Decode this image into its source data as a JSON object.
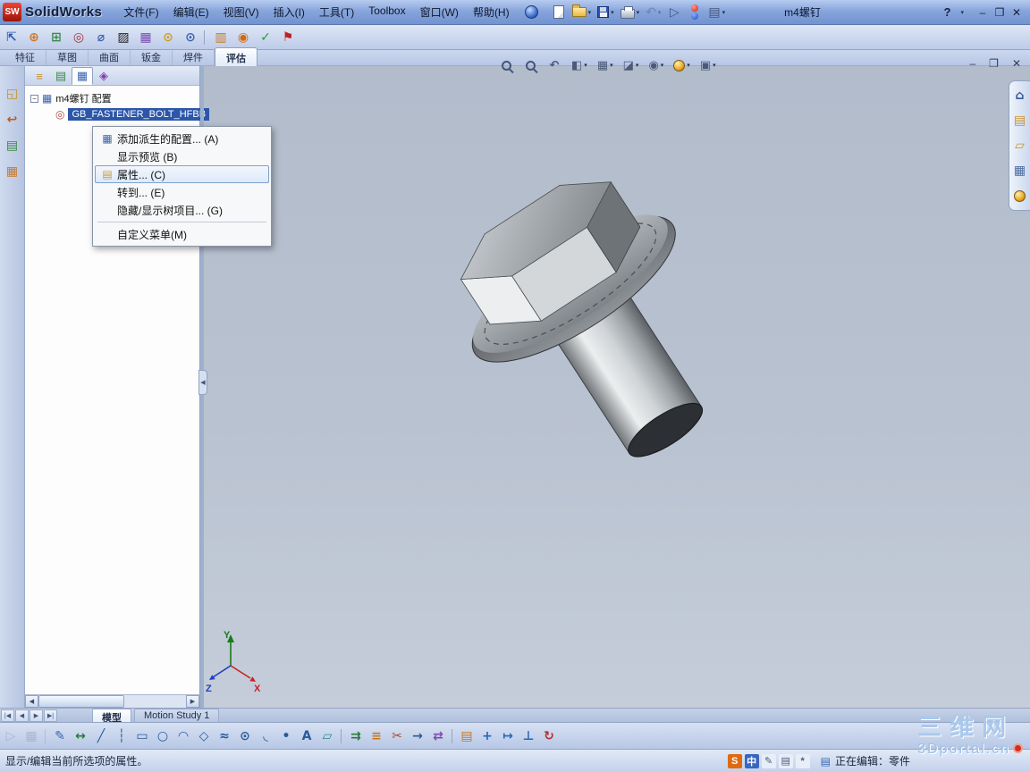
{
  "colors": {
    "selection_blue": "#2c56a8",
    "titlebar_blue": "#88a5dc",
    "viewport_gray": "#b9c2d0",
    "watermark_blue": "#a9c9ec"
  },
  "titlebar": {
    "app_name": "SolidWorks",
    "logo_text": "SW",
    "doc_title": "m4螺钉",
    "help_label": "?",
    "menus": [
      {
        "name": "menu-file",
        "label": "文件(F)"
      },
      {
        "name": "menu-edit",
        "label": "编辑(E)"
      },
      {
        "name": "menu-view",
        "label": "视图(V)"
      },
      {
        "name": "menu-insert",
        "label": "插入(I)"
      },
      {
        "name": "menu-tools",
        "label": "工具(T)"
      },
      {
        "name": "menu-toolbox",
        "label": "Toolbox"
      },
      {
        "name": "menu-window",
        "label": "窗口(W)"
      },
      {
        "name": "menu-help",
        "label": "帮助(H)"
      }
    ],
    "quick_icons": [
      {
        "name": "new-document-icon",
        "shape": "doc"
      },
      {
        "name": "open-icon",
        "shape": "folder",
        "dropdown": true
      },
      {
        "name": "save-icon",
        "shape": "save",
        "dropdown": true
      },
      {
        "name": "print-icon",
        "shape": "print",
        "dropdown": true
      },
      {
        "name": "undo-icon",
        "glyph": "↶",
        "color": "#5a6a88",
        "dropdown": true,
        "disabled": true
      },
      {
        "name": "select-arrow-icon",
        "glyph": "▷",
        "color": "#44567a"
      },
      {
        "name": "rebuild-icon",
        "shape": "rebuild"
      },
      {
        "name": "options-icon",
        "glyph": "▤",
        "color": "#44567a",
        "dropdown": true
      }
    ],
    "window_buttons": [
      {
        "name": "minimize-button",
        "glyph": "–"
      },
      {
        "name": "restore-button",
        "glyph": "❐"
      },
      {
        "name": "close-button",
        "glyph": "✕"
      }
    ]
  },
  "evaluate_toolbar": [
    {
      "name": "verification-icon",
      "glyph": "⇱",
      "color": "#2a5ab0"
    },
    {
      "name": "interference-detection-icon",
      "glyph": "⊕",
      "color": "#d07820"
    },
    {
      "name": "clearance-verification-icon",
      "glyph": "⊞",
      "color": "#3a8a4a"
    },
    {
      "name": "hole-alignment-icon",
      "glyph": "◎",
      "color": "#b03030"
    },
    {
      "name": "measure-icon",
      "glyph": "⌀",
      "color": "#3a62b0"
    },
    {
      "name": "section-properties-icon",
      "glyph": "▨",
      "color": "#222222"
    },
    {
      "name": "mass-properties-icon",
      "glyph": "▦",
      "color": "#7a4ab0"
    },
    {
      "name": "zoom-check-icon",
      "glyph": "⊙",
      "color": "#c8a020"
    },
    {
      "name": "magnifier-icon",
      "glyph": "⊙",
      "color": "#3a62b0",
      "sep": true
    },
    {
      "name": "statistics-icon",
      "glyph": "▥",
      "color": "#c87820"
    },
    {
      "name": "sensors-icon",
      "glyph": "◉",
      "color": "#d06a10"
    },
    {
      "name": "design-checker-icon",
      "glyph": "✓",
      "color": "#2a9a3a"
    },
    {
      "name": "compare-docs-icon",
      "glyph": "⚑",
      "color": "#c02020"
    }
  ],
  "command_tabs": [
    {
      "name": "tab-features",
      "label": "特征"
    },
    {
      "name": "tab-sketch",
      "label": "草图"
    },
    {
      "name": "tab-surfaces",
      "label": "曲面"
    },
    {
      "name": "tab-sheetmetal",
      "label": "钣金"
    },
    {
      "name": "tab-weldments",
      "label": "焊件"
    },
    {
      "name": "tab-evaluate",
      "label": "评估",
      "active": true
    }
  ],
  "headsup_toolbar": [
    {
      "name": "zoom-fit-icon",
      "shape": "mag"
    },
    {
      "name": "zoom-area-icon",
      "shape": "mag"
    },
    {
      "name": "previous-view-icon",
      "glyph": "↶"
    },
    {
      "name": "section-view-icon",
      "glyph": "◧",
      "dropdown": true
    },
    {
      "name": "view-orientation-icon",
      "glyph": "▦",
      "dropdown": true
    },
    {
      "name": "display-style-icon",
      "glyph": "◪",
      "dropdown": true
    },
    {
      "name": "hide-show-items-icon",
      "glyph": "◉",
      "dropdown": true
    },
    {
      "name": "edit-appearance-icon",
      "shape": "ball",
      "dropdown": true
    },
    {
      "name": "apply-scene-icon",
      "glyph": "▣",
      "dropdown": true
    }
  ],
  "left_dock": [
    {
      "name": "swift-arrow-icon",
      "glyph": "◱",
      "color": "#c8912a"
    },
    {
      "name": "rollback-icon",
      "glyph": "↩",
      "color": "#c05a20"
    },
    {
      "name": "design-binder-icon",
      "glyph": "▤",
      "color": "#3a8a4a"
    },
    {
      "name": "grid-pattern-icon",
      "glyph": "▦",
      "color": "#c8792a"
    }
  ],
  "task_pane": [
    {
      "name": "home-resources-icon",
      "glyph": "⌂",
      "color": "#3a5a9a"
    },
    {
      "name": "design-library-icon",
      "glyph": "▤",
      "color": "#c8912a"
    },
    {
      "name": "file-explorer-icon",
      "glyph": "▱",
      "color": "#c8912a"
    },
    {
      "name": "view-palette-icon",
      "glyph": "▦",
      "color": "#4a6aa0"
    },
    {
      "name": "appearances-icon",
      "shape": "ball"
    }
  ],
  "panel": {
    "tabs": [
      {
        "name": "featuremanager-tab",
        "glyph": "≡",
        "color": "#c8912a"
      },
      {
        "name": "propertymanager-tab",
        "glyph": "▤",
        "color": "#3a8a4a"
      },
      {
        "name": "configurationmanager-tab",
        "glyph": "▦",
        "color": "#3a66b0",
        "active": true
      },
      {
        "name": "dimxpert-tab",
        "glyph": "◈",
        "color": "#8a3ab0"
      }
    ],
    "tree": {
      "root_label": "m4螺钉 配置",
      "child_label": "GB_FASTENER_BOLT_HFBB",
      "expander": "−",
      "root_icon": "▦",
      "child_icon": "◎"
    }
  },
  "context_menu": [
    {
      "name": "menu-item-add-derived-config",
      "glyph": "▦",
      "color": "#3a66b0",
      "label": "添加派生的配置... (A)"
    },
    {
      "name": "menu-item-show-preview",
      "glyph": "",
      "label": "显示预览 (B)"
    },
    {
      "name": "menu-item-properties",
      "glyph": "▤",
      "color": "#c89a3a",
      "label": "属性... (C)",
      "highlight": true
    },
    {
      "name": "menu-item-go-to",
      "glyph": "",
      "label": "转到... (E)"
    },
    {
      "name": "menu-item-hide-show-tree",
      "glyph": "",
      "label": "隐藏/显示树项目... (G)",
      "sep": true
    },
    {
      "name": "menu-item-customize-menu",
      "glyph": "",
      "label": "自定义菜单(M)"
    }
  ],
  "viewport": {
    "triad": {
      "x_label": "X",
      "y_label": "Y",
      "z_label": "Z"
    }
  },
  "bottom_tabs": {
    "nav": [
      {
        "name": "first-tab-button",
        "glyph": "|◀"
      },
      {
        "name": "prev-tab-button",
        "glyph": "◀"
      },
      {
        "name": "next-tab-button",
        "glyph": "▶"
      },
      {
        "name": "last-tab-button",
        "glyph": "▶|"
      }
    ],
    "tabs": [
      {
        "name": "model-tab",
        "label": "模型",
        "active": true
      },
      {
        "name": "motion-study-tab",
        "label": "Motion Study 1"
      }
    ]
  },
  "sketch_toolbar": [
    {
      "name": "select-arrow-icon",
      "glyph": "▷",
      "color": "#8a93a3",
      "disabled": true
    },
    {
      "name": "grid-snap-icon",
      "glyph": "▦",
      "color": "#8a93a3",
      "disabled": true,
      "sep": true
    },
    {
      "name": "sketch-icon",
      "glyph": "✎",
      "color": "#3a66b0"
    },
    {
      "name": "smart-dimension-icon",
      "glyph": "↔",
      "color": "#2a7a3a"
    },
    {
      "name": "line-icon",
      "glyph": "╱",
      "color": "#2a5a9a"
    },
    {
      "name": "centerline-icon",
      "glyph": "┆",
      "color": "#2a5a9a"
    },
    {
      "name": "corner-rectangle-icon",
      "glyph": "▭",
      "color": "#2a5a9a"
    },
    {
      "name": "circle-icon",
      "glyph": "○",
      "color": "#2a5a9a"
    },
    {
      "name": "arc-icon",
      "glyph": "◠",
      "color": "#2a5a9a"
    },
    {
      "name": "polygon-icon",
      "glyph": "◇",
      "color": "#2a5a9a"
    },
    {
      "name": "spline-icon",
      "glyph": "≈",
      "color": "#2a5a9a"
    },
    {
      "name": "ellipse-icon",
      "glyph": "⊙",
      "color": "#2a5a9a"
    },
    {
      "name": "sketch-fillet-icon",
      "glyph": "◟",
      "color": "#2a5a9a"
    },
    {
      "name": "point-icon",
      "glyph": "•",
      "color": "#2a5a9a"
    },
    {
      "name": "text-icon",
      "glyph": "A",
      "color": "#2a5a9a"
    },
    {
      "name": "plane-icon",
      "glyph": "▱",
      "color": "#2a8a8a",
      "sep": true
    },
    {
      "name": "convert-entities-icon",
      "glyph": "⇉",
      "color": "#2a7a3a"
    },
    {
      "name": "offset-entities-icon",
      "glyph": "≡",
      "color": "#c87820"
    },
    {
      "name": "trim-entities-icon",
      "glyph": "✂",
      "color": "#b04a20"
    },
    {
      "name": "extend-entities-icon",
      "glyph": "→",
      "color": "#2a5a9a"
    },
    {
      "name": "mirror-entities-icon",
      "glyph": "⇄",
      "color": "#7a4ab0",
      "sep": true
    },
    {
      "name": "linear-pattern-icon",
      "glyph": "▤",
      "color": "#c87820"
    },
    {
      "name": "move-entities-icon",
      "glyph": "+",
      "color": "#2a66b8"
    },
    {
      "name": "display-relations-icon",
      "glyph": "↦",
      "color": "#2a66b8"
    },
    {
      "name": "add-relations-icon",
      "glyph": "⊥",
      "color": "#2a66b8"
    },
    {
      "name": "repair-sketch-icon",
      "glyph": "↻",
      "color": "#b03030"
    }
  ],
  "statusbar": {
    "left_text": "显示/编辑当前所选项的属性。",
    "editing_label": "正在编辑：零件",
    "tray": [
      {
        "name": "sogou-ime-icon",
        "glyph": "S",
        "bg": "#e06a10",
        "color": "#ffffff"
      },
      {
        "name": "ime-chinese-icon",
        "glyph": "中",
        "bg": "#3a66c0",
        "color": "#ffffff"
      },
      {
        "name": "ime-pen-icon",
        "glyph": "✎",
        "color": "#4a5a7a"
      },
      {
        "name": "ime-keyboard-icon",
        "glyph": "▤",
        "color": "#4a5a7a"
      },
      {
        "name": "ime-tools-icon",
        "glyph": "*",
        "color": "#4a5a7a"
      }
    ]
  },
  "watermark": {
    "line1": "三维网",
    "line2": "3Dportal.cn"
  }
}
